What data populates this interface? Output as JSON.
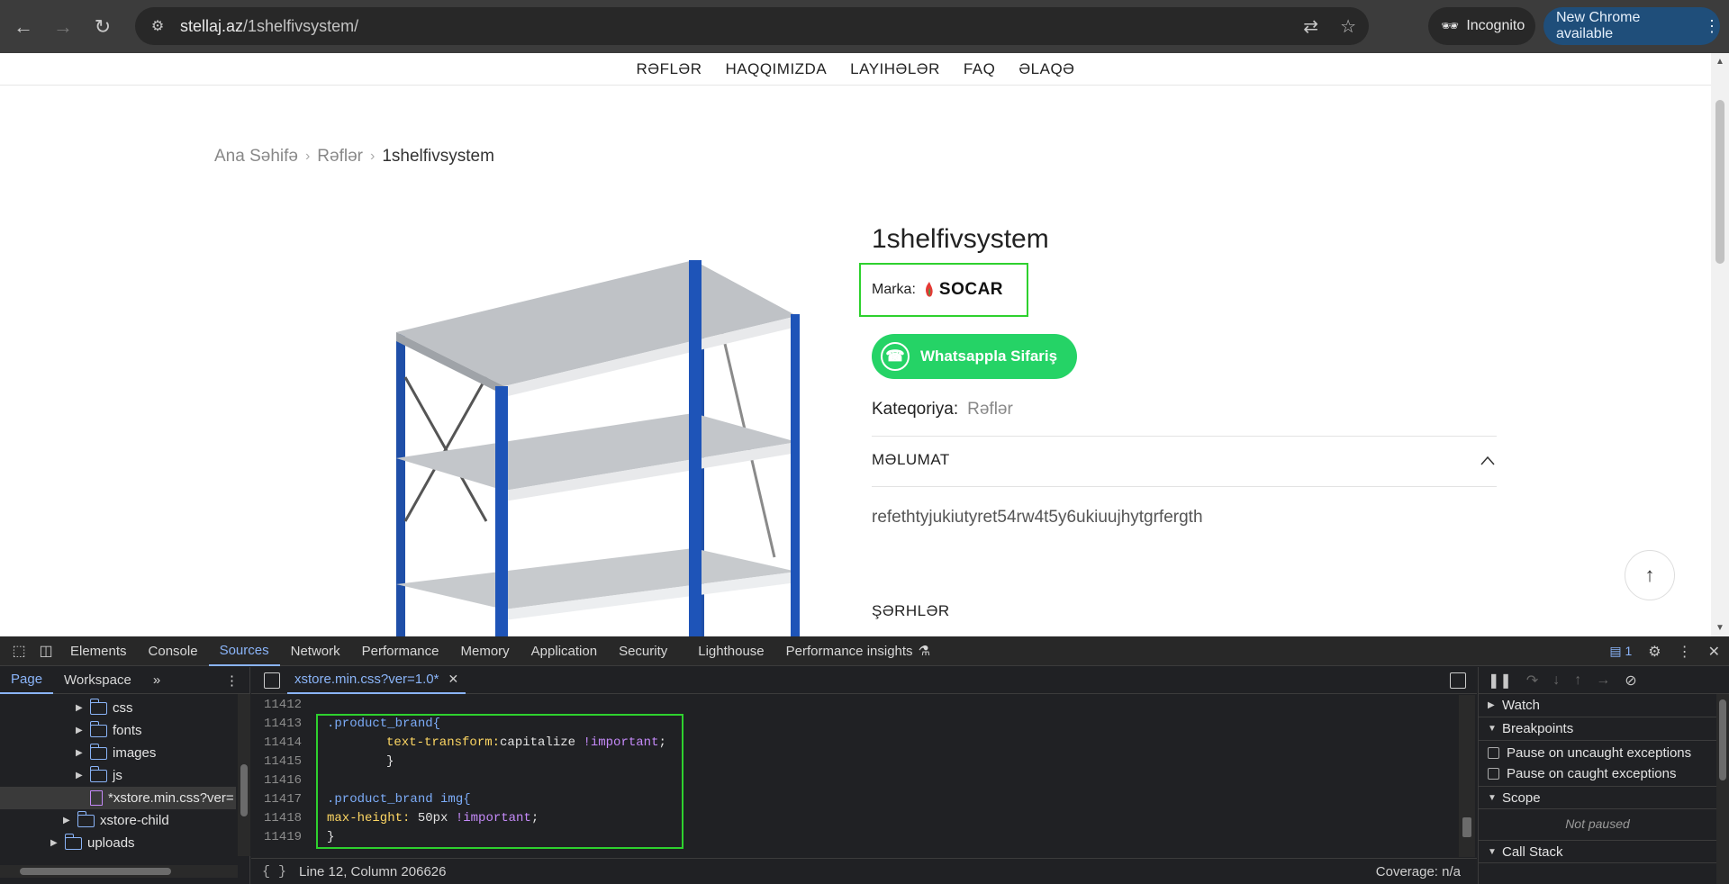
{
  "browser": {
    "url_host": "stellaj.az",
    "url_path": "/1shelfivsystem/",
    "incognito_label": "Incognito",
    "update_label": "New Chrome available"
  },
  "site": {
    "nav": [
      "RƏFLƏR",
      "HAQQIMIZDA",
      "LAYIHƏLƏR",
      "FAQ",
      "ƏLAQƏ"
    ],
    "breadcrumb": {
      "home": "Ana Səhifə",
      "category": "Rəflər",
      "current": "1shelfivsystem"
    },
    "product": {
      "title": "1shelfivsystem",
      "brand_label": "Marka:",
      "brand_name": "SOCAR",
      "whatsapp_label": "Whatsappla Sifariş",
      "category_label": "Kateqoriya:",
      "category_value": "Rəflər",
      "info_title": "MƏLUMAT",
      "info_body": "refethtyjukiutyret54rw4t5y6ukiuujhytgrfergth",
      "comments_title": "ŞƏRHLƏR"
    }
  },
  "devtools": {
    "tabs": [
      "Elements",
      "Console",
      "Sources",
      "Network",
      "Performance",
      "Memory",
      "Application",
      "Security",
      "Lighthouse",
      "Performance insights"
    ],
    "active_tab": "Sources",
    "issues_count": "1",
    "navigator": {
      "tabs": [
        "Page",
        "Workspace"
      ],
      "active_tab": "Page",
      "tree": [
        {
          "label": "css",
          "type": "folder"
        },
        {
          "label": "fonts",
          "type": "folder"
        },
        {
          "label": "images",
          "type": "folder"
        },
        {
          "label": "js",
          "type": "folder"
        },
        {
          "label": "*xstore.min.css?ver=",
          "type": "file"
        },
        {
          "label": "xstore-child",
          "type": "folder"
        },
        {
          "label": "uploads",
          "type": "folder"
        }
      ]
    },
    "editor": {
      "file_tab": "xstore.min.css?ver=1.0*",
      "lines": [
        {
          "n": "11412",
          "text": ""
        },
        {
          "n": "11413",
          "text": ".product_brand{"
        },
        {
          "n": "11414",
          "text": "text-transform:capitalize !important;"
        },
        {
          "n": "11415",
          "text": "}"
        },
        {
          "n": "11416",
          "text": ""
        },
        {
          "n": "11417",
          "text": ".product_brand img{"
        },
        {
          "n": "11418",
          "text": "max-height: 50px !important;"
        },
        {
          "n": "11419",
          "text": "}"
        }
      ],
      "status_position": "Line 12, Column 206626",
      "status_coverage": "Coverage: n/a"
    },
    "debugger": {
      "watch": "Watch",
      "breakpoints": "Breakpoints",
      "pause_uncaught": "Pause on uncaught exceptions",
      "pause_caught": "Pause on caught exceptions",
      "scope": "Scope",
      "not_paused": "Not paused",
      "call_stack": "Call Stack"
    }
  }
}
